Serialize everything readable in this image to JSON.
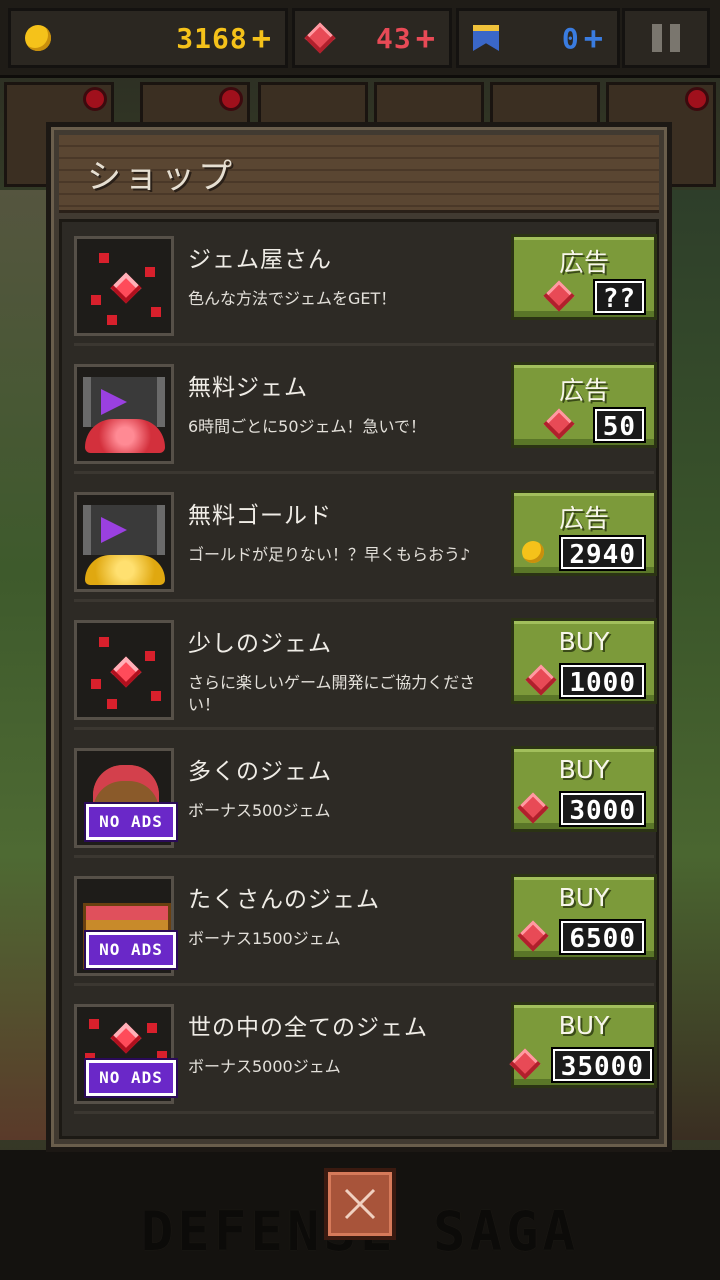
{
  "topbar": {
    "gold": "3168",
    "gems": "43",
    "tickets": "0",
    "plus": "+",
    "colors": {
      "gold": "#f5c21a",
      "gems": "#e84a56",
      "tickets": "#3a7ce0"
    }
  },
  "shop": {
    "title": "ショップ",
    "items": [
      {
        "name": "ジェム屋さん",
        "desc": "色んな方法でジェムをGET！",
        "button": "広告",
        "price": "??",
        "currency": "gem-icon"
      },
      {
        "name": "無料ジェム",
        "desc": "6時間ごとに50ジェム！急いで！",
        "button": "広告",
        "price": "50",
        "currency": "gem-icon"
      },
      {
        "name": "無料ゴールド",
        "desc": "ゴールドが足りない！？早くもらおう♪",
        "button": "広告",
        "price": "2940",
        "currency": "coin-icon"
      },
      {
        "name": "少しのジェム",
        "desc": "さらに楽しいゲーム開発にご協力ください！",
        "button": "BUY",
        "price": "1000",
        "currency": "gem-icon"
      },
      {
        "name": "多くのジェム",
        "desc": "ボーナス500ジェム",
        "button": "BUY",
        "price": "3000",
        "currency": "gem-icon",
        "badge": "NO ADS"
      },
      {
        "name": "たくさんのジェム",
        "desc": "ボーナス1500ジェム",
        "button": "BUY",
        "price": "6500",
        "currency": "gem-icon",
        "badge": "NO ADS"
      },
      {
        "name": "世の中の全てのジェム",
        "desc": "ボーナス5000ジェム",
        "button": "BUY",
        "price": "35000",
        "currency": "gem-icon",
        "badge": "NO ADS"
      }
    ]
  },
  "footer": {
    "logo": "DEFENSE SAGA"
  },
  "colors": {
    "button_green": "#7c9a3a",
    "badge_purple": "#6a28c8",
    "close_button": "#a8543a"
  }
}
